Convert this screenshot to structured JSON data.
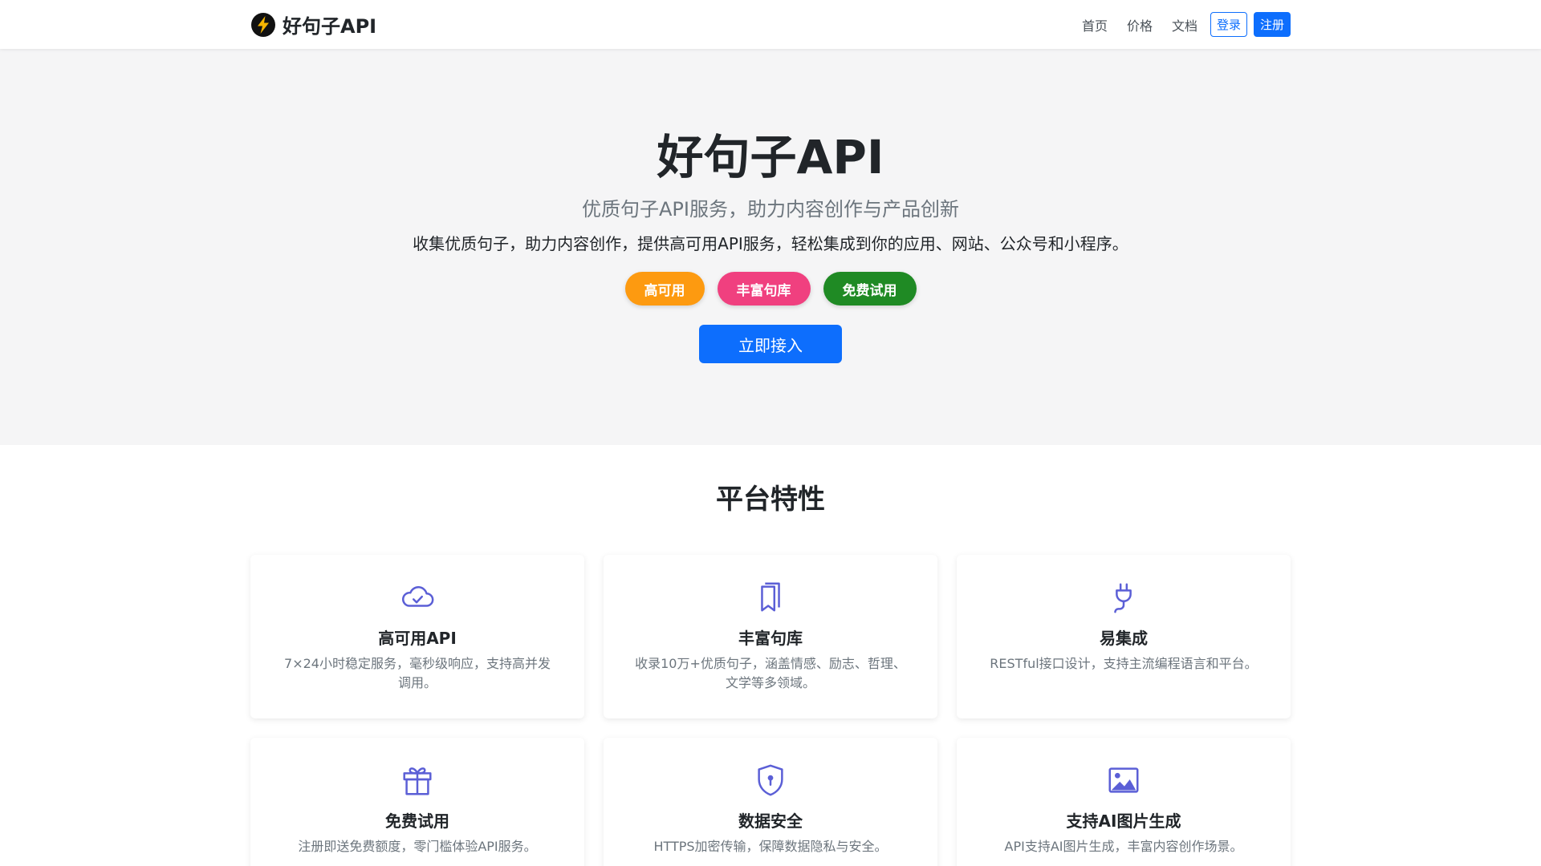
{
  "nav": {
    "brand": "好句子API",
    "logo_icon": "lightning-bolt-icon",
    "links": [
      "首页",
      "价格",
      "文档"
    ],
    "login": "登录",
    "register": "注册"
  },
  "hero": {
    "title": "好句子API",
    "subtitle": "优质句子API服务，助力内容创作与产品创新",
    "description": "收集优质句子，助力内容创作，提供高可用API服务，轻松集成到你的应用、网站、公众号和小程序。",
    "badges": [
      {
        "label": "高可用",
        "color": "#fd9a10"
      },
      {
        "label": "丰富句库",
        "color": "#f0407f"
      },
      {
        "label": "免费试用",
        "color": "#1f8a24"
      }
    ],
    "cta": "立即接入"
  },
  "features": {
    "title": "平台特性",
    "icon_color": "#5b5fd6",
    "items": [
      {
        "icon": "cloud-check-icon",
        "title": "高可用API",
        "desc": "7×24小时稳定服务，毫秒级响应，支持高并发调用。"
      },
      {
        "icon": "bookmarks-icon",
        "title": "丰富句库",
        "desc": "收录10万+优质句子，涵盖情感、励志、哲理、文学等多领域。"
      },
      {
        "icon": "plug-icon",
        "title": "易集成",
        "desc": "RESTful接口设计，支持主流编程语言和平台。"
      },
      {
        "icon": "gift-icon",
        "title": "免费试用",
        "desc": "注册即送免费额度，零门槛体验API服务。"
      },
      {
        "icon": "shield-lock-icon",
        "title": "数据安全",
        "desc": "HTTPS加密传输，保障数据隐私与安全。"
      },
      {
        "icon": "image-icon",
        "title": "支持AI图片生成",
        "desc": "API支持AI图片生成，丰富内容创作场景。"
      }
    ]
  }
}
